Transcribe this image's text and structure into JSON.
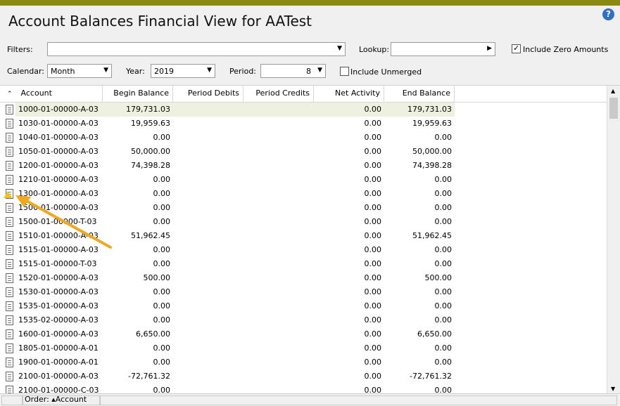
{
  "window": {
    "title": "Account Balances Financial View for AATest"
  },
  "help": {
    "icon": "help-icon",
    "glyph": "?"
  },
  "filters": {
    "filters_label": "Filters:",
    "filters_value": "",
    "lookup_label": "Lookup:",
    "lookup_value": "",
    "include_zero_label": "Include Zero Amounts",
    "include_zero_checked": true,
    "calendar_label": "Calendar:",
    "calendar_value": "Month",
    "year_label": "Year:",
    "year_value": "2019",
    "period_label": "Period:",
    "period_value": "8",
    "include_unmerged_label": "Include Unmerged",
    "include_unmerged_checked": false
  },
  "grid": {
    "columns": [
      "Account",
      "Begin Balance",
      "Period Debits",
      "Period Credits",
      "Net Activity",
      "End Balance"
    ],
    "rows": [
      {
        "account": "1000-01-00000-A-03",
        "begin": "179,731.03",
        "debits": "",
        "credits": "",
        "net": "0.00",
        "end": "179,731.03"
      },
      {
        "account": "1030-01-00000-A-03",
        "begin": "19,959.63",
        "debits": "",
        "credits": "",
        "net": "0.00",
        "end": "19,959.63"
      },
      {
        "account": "1040-01-00000-A-03",
        "begin": "0.00",
        "debits": "",
        "credits": "",
        "net": "0.00",
        "end": "0.00"
      },
      {
        "account": "1050-01-00000-A-03",
        "begin": "50,000.00",
        "debits": "",
        "credits": "",
        "net": "0.00",
        "end": "50,000.00"
      },
      {
        "account": "1200-01-00000-A-03",
        "begin": "74,398.28",
        "debits": "",
        "credits": "",
        "net": "0.00",
        "end": "74,398.28"
      },
      {
        "account": "1210-01-00000-A-03",
        "begin": "0.00",
        "debits": "",
        "credits": "",
        "net": "0.00",
        "end": "0.00"
      },
      {
        "account": "1300-01-00000-A-03",
        "begin": "0.00",
        "debits": "",
        "credits": "",
        "net": "0.00",
        "end": "0.00"
      },
      {
        "account": "1500-01-00000-A-03",
        "begin": "0.00",
        "debits": "",
        "credits": "",
        "net": "0.00",
        "end": "0.00"
      },
      {
        "account": "1500-01-00000-T-03",
        "begin": "0.00",
        "debits": "",
        "credits": "",
        "net": "0.00",
        "end": "0.00"
      },
      {
        "account": "1510-01-00000-A-03",
        "begin": "51,962.45",
        "debits": "",
        "credits": "",
        "net": "0.00",
        "end": "51,962.45"
      },
      {
        "account": "1515-01-00000-A-03",
        "begin": "0.00",
        "debits": "",
        "credits": "",
        "net": "0.00",
        "end": "0.00"
      },
      {
        "account": "1515-01-00000-T-03",
        "begin": "0.00",
        "debits": "",
        "credits": "",
        "net": "0.00",
        "end": "0.00"
      },
      {
        "account": "1520-01-00000-A-03",
        "begin": "500.00",
        "debits": "",
        "credits": "",
        "net": "0.00",
        "end": "500.00"
      },
      {
        "account": "1530-01-00000-A-03",
        "begin": "0.00",
        "debits": "",
        "credits": "",
        "net": "0.00",
        "end": "0.00"
      },
      {
        "account": "1535-01-00000-A-03",
        "begin": "0.00",
        "debits": "",
        "credits": "",
        "net": "0.00",
        "end": "0.00"
      },
      {
        "account": "1535-02-00000-A-03",
        "begin": "0.00",
        "debits": "",
        "credits": "",
        "net": "0.00",
        "end": "0.00"
      },
      {
        "account": "1600-01-00000-A-03",
        "begin": "6,650.00",
        "debits": "",
        "credits": "",
        "net": "0.00",
        "end": "6,650.00"
      },
      {
        "account": "1805-01-00000-A-01",
        "begin": "0.00",
        "debits": "",
        "credits": "",
        "net": "0.00",
        "end": "0.00"
      },
      {
        "account": "1900-01-00000-A-01",
        "begin": "0.00",
        "debits": "",
        "credits": "",
        "net": "0.00",
        "end": "0.00"
      },
      {
        "account": "2100-01-00000-A-03",
        "begin": "-72,761.32",
        "debits": "",
        "credits": "",
        "net": "0.00",
        "end": "-72,761.32"
      },
      {
        "account": "2100-01-00000-C-03",
        "begin": "0.00",
        "debits": "",
        "credits": "",
        "net": "0.00",
        "end": "0.00"
      }
    ]
  },
  "status": {
    "order_label": "Order:",
    "order_value": "▴Account"
  },
  "colors": {
    "topbar": "#8a8a13",
    "annotation_arrow": "#f0a81c",
    "selected_row": "#eef0e0"
  }
}
